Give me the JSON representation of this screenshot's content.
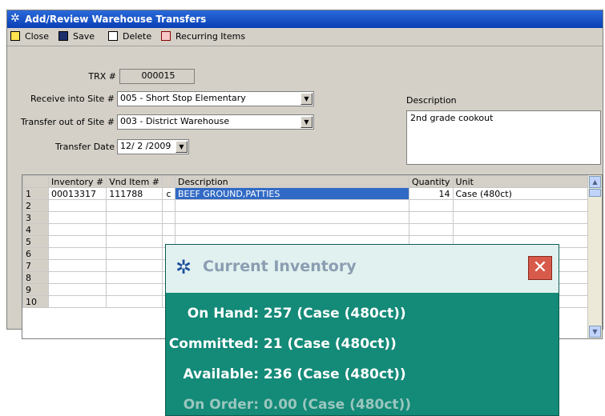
{
  "window": {
    "title": "Add/Review Warehouse Transfers"
  },
  "toolbar": {
    "close": "Close",
    "save": "Save",
    "delete": "Delete",
    "recurring": "Recurring Items"
  },
  "form": {
    "trx_label": "TRX #",
    "trx_value": "000015",
    "receive_label": "Receive into Site #",
    "receive_value": "005 - Short Stop Elementary",
    "transfer_out_label": "Transfer out of Site #",
    "transfer_out_value": "003 - District Warehouse",
    "date_label": "Transfer Date",
    "date_value": "12/ 2 /2009",
    "description_label": "Description",
    "description_value": "2nd grade cookout"
  },
  "grid": {
    "headers": [
      "",
      "Inventory #",
      "Vnd Item #",
      "",
      "Description",
      "Quantity",
      "Unit"
    ],
    "rows": [
      [
        "1",
        "00013317",
        "111788",
        "c",
        "BEEF GROUND,PATTIES",
        "14",
        "Case (480ct)"
      ],
      [
        "2",
        "",
        "",
        "",
        "",
        "",
        ""
      ],
      [
        "3",
        "",
        "",
        "",
        "",
        "",
        ""
      ],
      [
        "4",
        "",
        "",
        "",
        "",
        "",
        ""
      ],
      [
        "5",
        "",
        "",
        "",
        "",
        "",
        ""
      ],
      [
        "6",
        "",
        "",
        "",
        "",
        "",
        ""
      ],
      [
        "7",
        "",
        "",
        "",
        "",
        "",
        ""
      ],
      [
        "8",
        "",
        "",
        "",
        "",
        "",
        ""
      ],
      [
        "9",
        "",
        "",
        "",
        "",
        "",
        ""
      ],
      [
        "10",
        "",
        "",
        "",
        "",
        "",
        ""
      ]
    ]
  },
  "popup": {
    "title": "Current Inventory",
    "on_hand_label": "On Hand:",
    "on_hand_value": "257  (Case (480ct))",
    "committed_label": "Committed:",
    "committed_value": "21  (Case (480ct))",
    "available_label": "Available:",
    "available_value": "236  (Case (480ct))",
    "on_order_label": "On Order:",
    "on_order_value": "0.00 (Case (480ct))"
  }
}
